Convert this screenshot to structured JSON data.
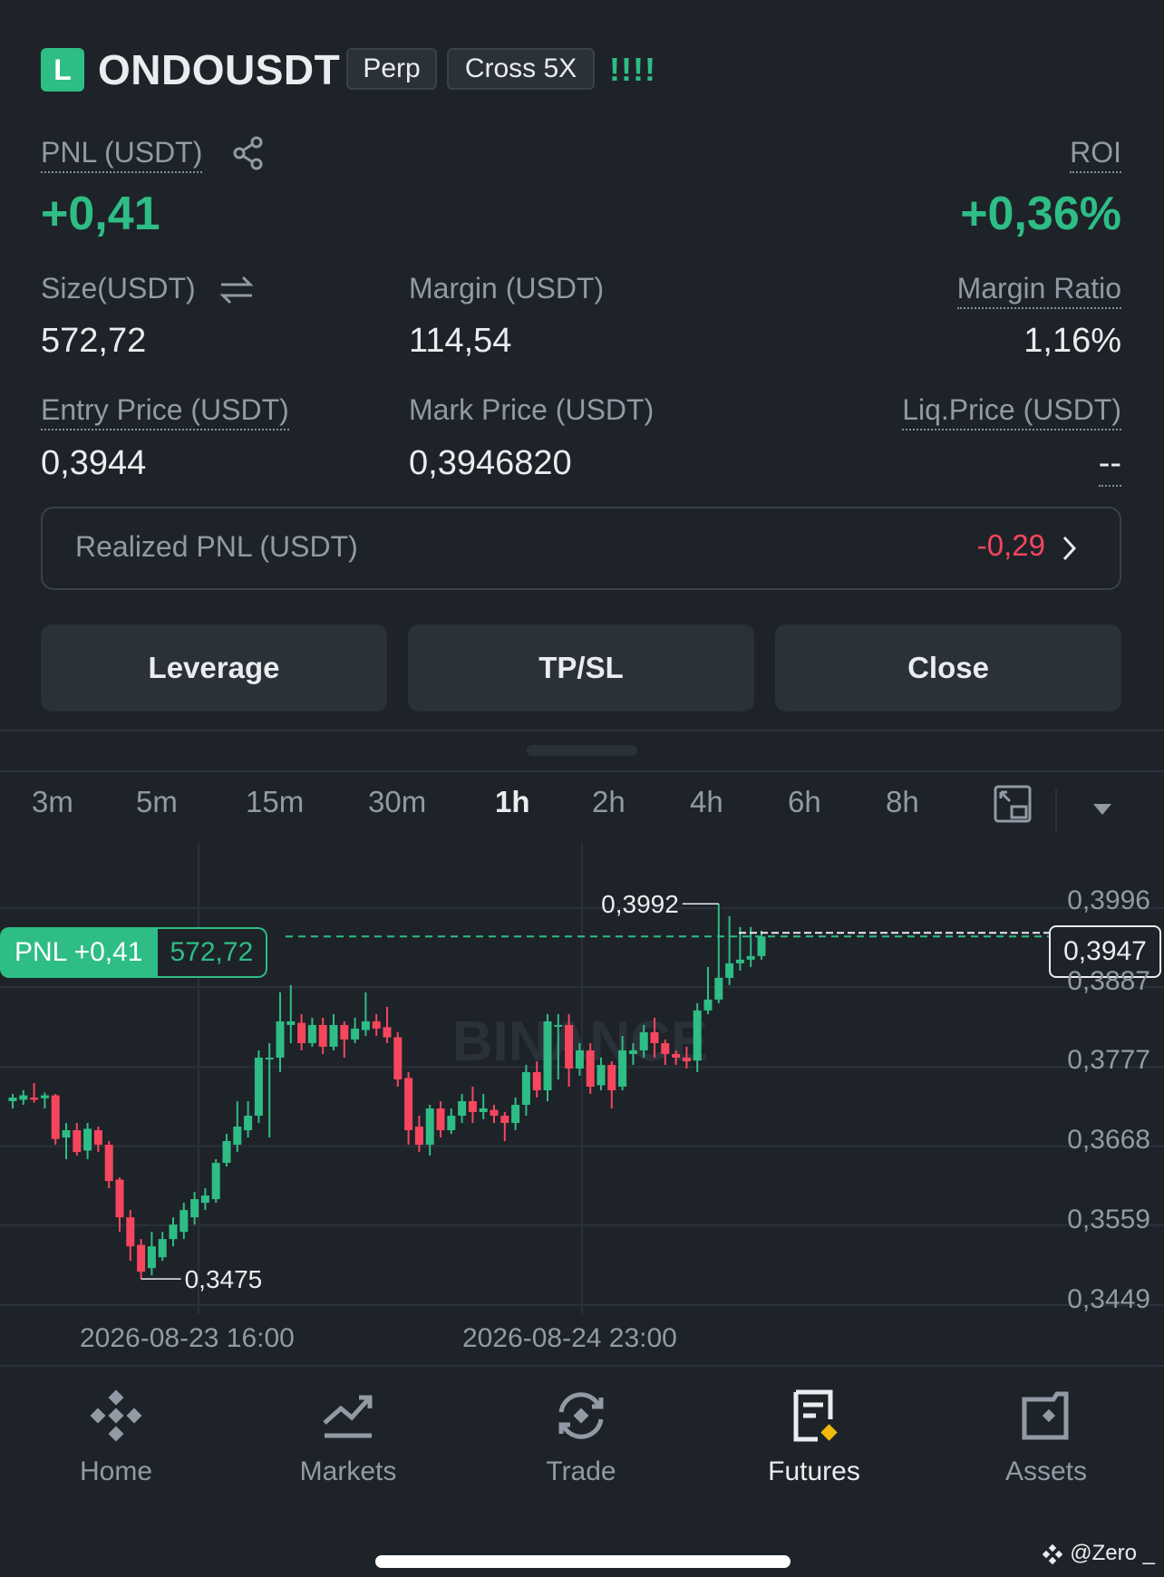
{
  "header": {
    "side_badge": "L",
    "symbol": "ONDOUSDT",
    "tags": [
      "Perp",
      "Cross 5X"
    ],
    "signal": "!!!!"
  },
  "position": {
    "pnl_label": "PNL (USDT)",
    "pnl_value": "+0,41",
    "roi_label": "ROI",
    "roi_value": "+0,36%",
    "size_label": "Size(USDT)",
    "size_value": "572,72",
    "margin_label": "Margin (USDT)",
    "margin_value": "114,54",
    "margin_ratio_label": "Margin Ratio",
    "margin_ratio_value": "1,16%",
    "entry_label": "Entry Price (USDT)",
    "entry_value": "0,3944",
    "mark_label": "Mark Price (USDT)",
    "mark_value": "0,3946820",
    "liq_label": "Liq.Price (USDT)",
    "liq_value": "--",
    "realized_label": "Realized PNL (USDT)",
    "realized_value": "-0,29"
  },
  "actions": [
    "Leverage",
    "TP/SL",
    "Close"
  ],
  "timeframes": [
    "3m",
    "5m",
    "15m",
    "30m",
    "1h",
    "2h",
    "4h",
    "6h",
    "8h"
  ],
  "active_timeframe": "1h",
  "chart_overlay": {
    "pnl_tag_label": "PNL +0,41",
    "pnl_tag_size": "572,72",
    "current_price": "0,3947",
    "high_label": "0,3992",
    "low_label": "0,3475",
    "watermark": "BINANCE"
  },
  "chart_data": {
    "type": "candlestick",
    "y_ticks": [
      "0,3996",
      "0,3887",
      "0,3777",
      "0,3668",
      "0,3559",
      "0,3449"
    ],
    "x_ticks": [
      "2026-08-23 16:00",
      "2026-08-24 23:00"
    ],
    "ylim": [
      0.3449,
      0.3996
    ],
    "candles": [
      [
        0.372,
        0.3725,
        0.371,
        0.373
      ],
      [
        0.3722,
        0.3728,
        0.3715,
        0.3735
      ],
      [
        0.3725,
        0.3722,
        0.3718,
        0.3745
      ],
      [
        0.3724,
        0.3728,
        0.371,
        0.3732
      ],
      [
        0.3728,
        0.3668,
        0.366,
        0.373
      ],
      [
        0.367,
        0.368,
        0.364,
        0.369
      ],
      [
        0.368,
        0.365,
        0.3645,
        0.369
      ],
      [
        0.3652,
        0.3682,
        0.364,
        0.369
      ],
      [
        0.368,
        0.366,
        0.365,
        0.3685
      ],
      [
        0.366,
        0.361,
        0.36,
        0.3665
      ],
      [
        0.3612,
        0.356,
        0.354,
        0.3615
      ],
      [
        0.356,
        0.352,
        0.35,
        0.357
      ],
      [
        0.3522,
        0.3485,
        0.3475,
        0.353
      ],
      [
        0.349,
        0.352,
        0.348,
        0.354
      ],
      [
        0.3505,
        0.353,
        0.35,
        0.354
      ],
      [
        0.353,
        0.355,
        0.352,
        0.356
      ],
      [
        0.354,
        0.357,
        0.353,
        0.358
      ],
      [
        0.356,
        0.3585,
        0.355,
        0.3595
      ],
      [
        0.358,
        0.359,
        0.357,
        0.36
      ],
      [
        0.3585,
        0.3635,
        0.358,
        0.364
      ],
      [
        0.3635,
        0.3665,
        0.363,
        0.3675
      ],
      [
        0.366,
        0.3685,
        0.365,
        0.372
      ],
      [
        0.368,
        0.37,
        0.367,
        0.372
      ],
      [
        0.37,
        0.378,
        0.369,
        0.379
      ],
      [
        0.378,
        0.378,
        0.367,
        0.38
      ],
      [
        0.378,
        0.383,
        0.376,
        0.387
      ],
      [
        0.3825,
        0.383,
        0.38,
        0.388
      ],
      [
        0.3828,
        0.38,
        0.379,
        0.384
      ],
      [
        0.38,
        0.3825,
        0.3795,
        0.3835
      ],
      [
        0.3825,
        0.3795,
        0.3785,
        0.3835
      ],
      [
        0.3795,
        0.3825,
        0.379,
        0.384
      ],
      [
        0.3825,
        0.3805,
        0.378,
        0.383
      ],
      [
        0.3805,
        0.382,
        0.38,
        0.3835
      ],
      [
        0.3818,
        0.383,
        0.381,
        0.387
      ],
      [
        0.383,
        0.382,
        0.381,
        0.384
      ],
      [
        0.3822,
        0.3808,
        0.38,
        0.385
      ],
      [
        0.3808,
        0.375,
        0.374,
        0.3815
      ],
      [
        0.3752,
        0.368,
        0.366,
        0.376
      ],
      [
        0.3685,
        0.366,
        0.365,
        0.37
      ],
      [
        0.366,
        0.371,
        0.3645,
        0.3715
      ],
      [
        0.371,
        0.368,
        0.367,
        0.372
      ],
      [
        0.368,
        0.37,
        0.3675,
        0.371
      ],
      [
        0.37,
        0.372,
        0.369,
        0.373
      ],
      [
        0.372,
        0.3705,
        0.369,
        0.374
      ],
      [
        0.3705,
        0.371,
        0.3695,
        0.373
      ],
      [
        0.3708,
        0.37,
        0.369,
        0.3715
      ],
      [
        0.37,
        0.369,
        0.3665,
        0.3705
      ],
      [
        0.369,
        0.3715,
        0.368,
        0.3725
      ],
      [
        0.3715,
        0.376,
        0.37,
        0.377
      ],
      [
        0.376,
        0.3735,
        0.3725,
        0.3775
      ],
      [
        0.3735,
        0.383,
        0.372,
        0.384
      ],
      [
        0.3825,
        0.3825,
        0.375,
        0.384
      ],
      [
        0.3825,
        0.3765,
        0.374,
        0.384
      ],
      [
        0.3765,
        0.379,
        0.3755,
        0.38
      ],
      [
        0.379,
        0.374,
        0.373,
        0.38
      ],
      [
        0.3742,
        0.377,
        0.3735,
        0.378
      ],
      [
        0.377,
        0.3735,
        0.371,
        0.3775
      ],
      [
        0.374,
        0.379,
        0.3735,
        0.381
      ],
      [
        0.3785,
        0.379,
        0.377,
        0.38
      ],
      [
        0.379,
        0.3815,
        0.378,
        0.3825
      ],
      [
        0.3815,
        0.38,
        0.378,
        0.3835
      ],
      [
        0.38,
        0.3785,
        0.377,
        0.3805
      ],
      [
        0.3785,
        0.378,
        0.377,
        0.379
      ],
      [
        0.378,
        0.3775,
        0.3765,
        0.3795
      ],
      [
        0.3776,
        0.3845,
        0.376,
        0.3855
      ],
      [
        0.3845,
        0.386,
        0.384,
        0.3905
      ],
      [
        0.386,
        0.389,
        0.3855,
        0.3992
      ],
      [
        0.389,
        0.391,
        0.388,
        0.3975
      ],
      [
        0.391,
        0.3915,
        0.39,
        0.396
      ],
      [
        0.3915,
        0.392,
        0.3905,
        0.396
      ],
      [
        0.392,
        0.3947,
        0.3915,
        0.3955
      ]
    ]
  },
  "nav": {
    "items": [
      {
        "label": "Home",
        "icon": "binance-logo-icon"
      },
      {
        "label": "Markets",
        "icon": "trend-chart-icon"
      },
      {
        "label": "Trade",
        "icon": "trade-swap-icon"
      },
      {
        "label": "Futures",
        "icon": "futures-doc-icon"
      },
      {
        "label": "Assets",
        "icon": "wallet-icon"
      }
    ],
    "active": "Futures"
  },
  "footer_tag": "@Zero _"
}
